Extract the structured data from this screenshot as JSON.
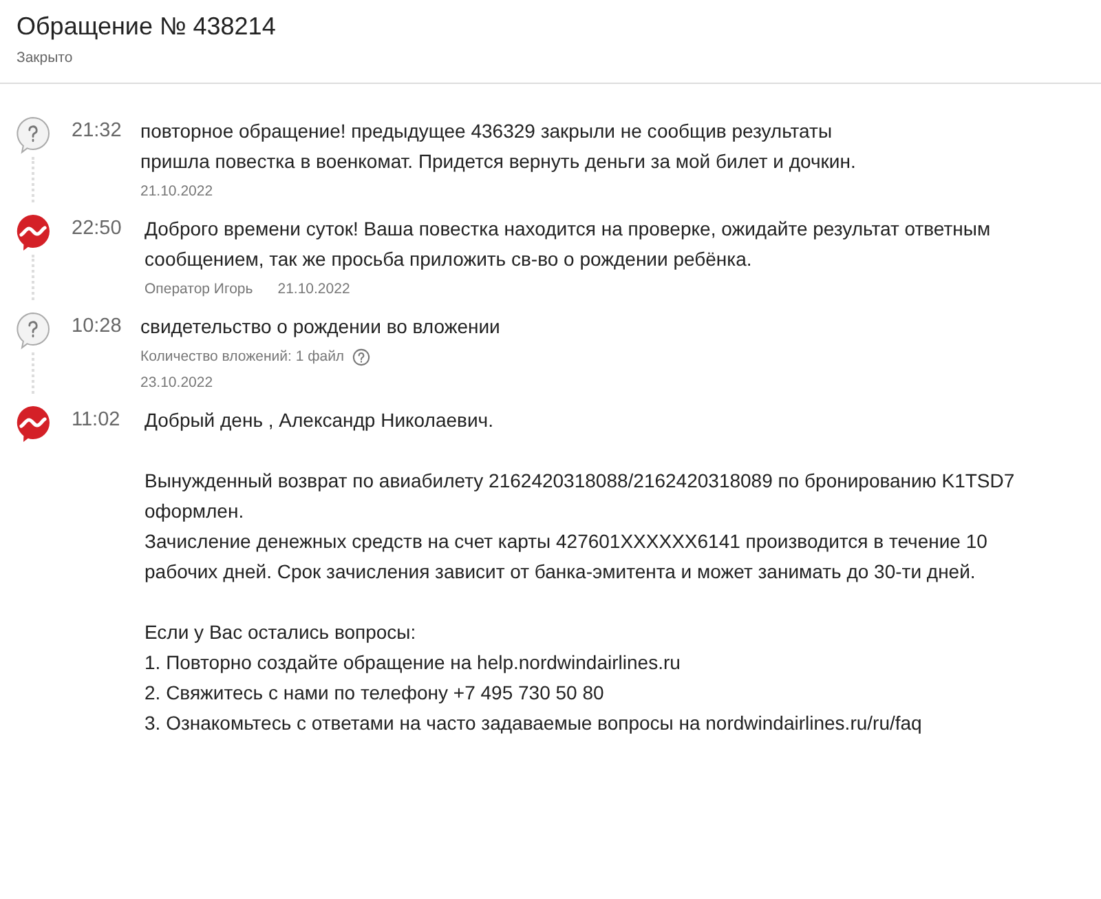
{
  "title": "Обращение № 438214",
  "status": "Закрыто",
  "messages": [
    {
      "kind": "user",
      "time": "21:32",
      "paragraphs": [
        [
          "повторное обращение! предыдущее 436329 закрыли не сообщив результаты",
          "пришла повестка в военкомат. Придется вернуть деньги за мой билет и дочкин."
        ]
      ],
      "date": "21.10.2022"
    },
    {
      "kind": "operator",
      "time": "22:50",
      "paragraphs": [
        [
          "Доброго времени суток! Ваша повестка находится на проверке, ожидайте результат ответным",
          "сообщением, так же просьба приложить св-во о рождении ребёнка."
        ]
      ],
      "author": "Оператор Игорь",
      "date": "21.10.2022"
    },
    {
      "kind": "user",
      "time": "10:28",
      "paragraphs": [
        [
          "свидетельство о рождении во вложении"
        ]
      ],
      "attachments": "Количество вложений: 1 файл",
      "date": "23.10.2022"
    },
    {
      "kind": "operator",
      "time": "11:02",
      "paragraphs": [
        [
          "Добрый день , Александр Николаевич."
        ],
        [
          "Вынужденный возврат по авиабилету 2162420318088/2162420318089 по бронированию K1TSD7",
          "оформлен.",
          "Зачисление денежных средств на счет карты 427601XXXXXX6141 производится в течение 10",
          "рабочих дней. Срок зачисления зависит от банка-эмитента и может занимать до 30-ти дней."
        ],
        [
          "Если у Вас остались вопросы:",
          "1. Повторно создайте обращение на help.nordwindairlines.ru",
          "2. Свяжитесь с нами по телефону +7 495 730 50 80",
          "3. Ознакомьтесь с ответами на часто задаваемые вопросы на nordwindairlines.ru/ru/faq"
        ]
      ]
    }
  ]
}
